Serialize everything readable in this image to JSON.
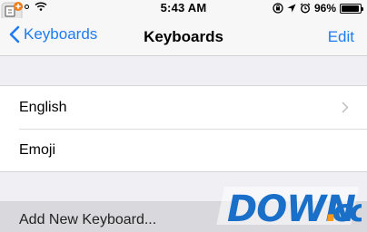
{
  "status_bar": {
    "time": "5:43 AM",
    "battery_percent": "96%",
    "battery_level": 0.96,
    "icons": [
      "signal-icon",
      "wifi-icon",
      "portrait-lock-icon",
      "location-icon",
      "alarm-icon",
      "battery-icon"
    ]
  },
  "nav": {
    "back_label": "Keyboards",
    "title": "Keyboards",
    "edit_label": "Edit"
  },
  "keyboards": [
    {
      "label": "English"
    },
    {
      "label": "Emoji"
    }
  ],
  "add_keyboard": {
    "label": "Add New Keyboard..."
  },
  "watermark": {
    "text": "DOWN.cc"
  },
  "colors": {
    "accent": "#1f7bf2",
    "background": "#efeff4",
    "watermark_blue": "#1a6fc8",
    "watermark_orange": "#f39a1d"
  }
}
